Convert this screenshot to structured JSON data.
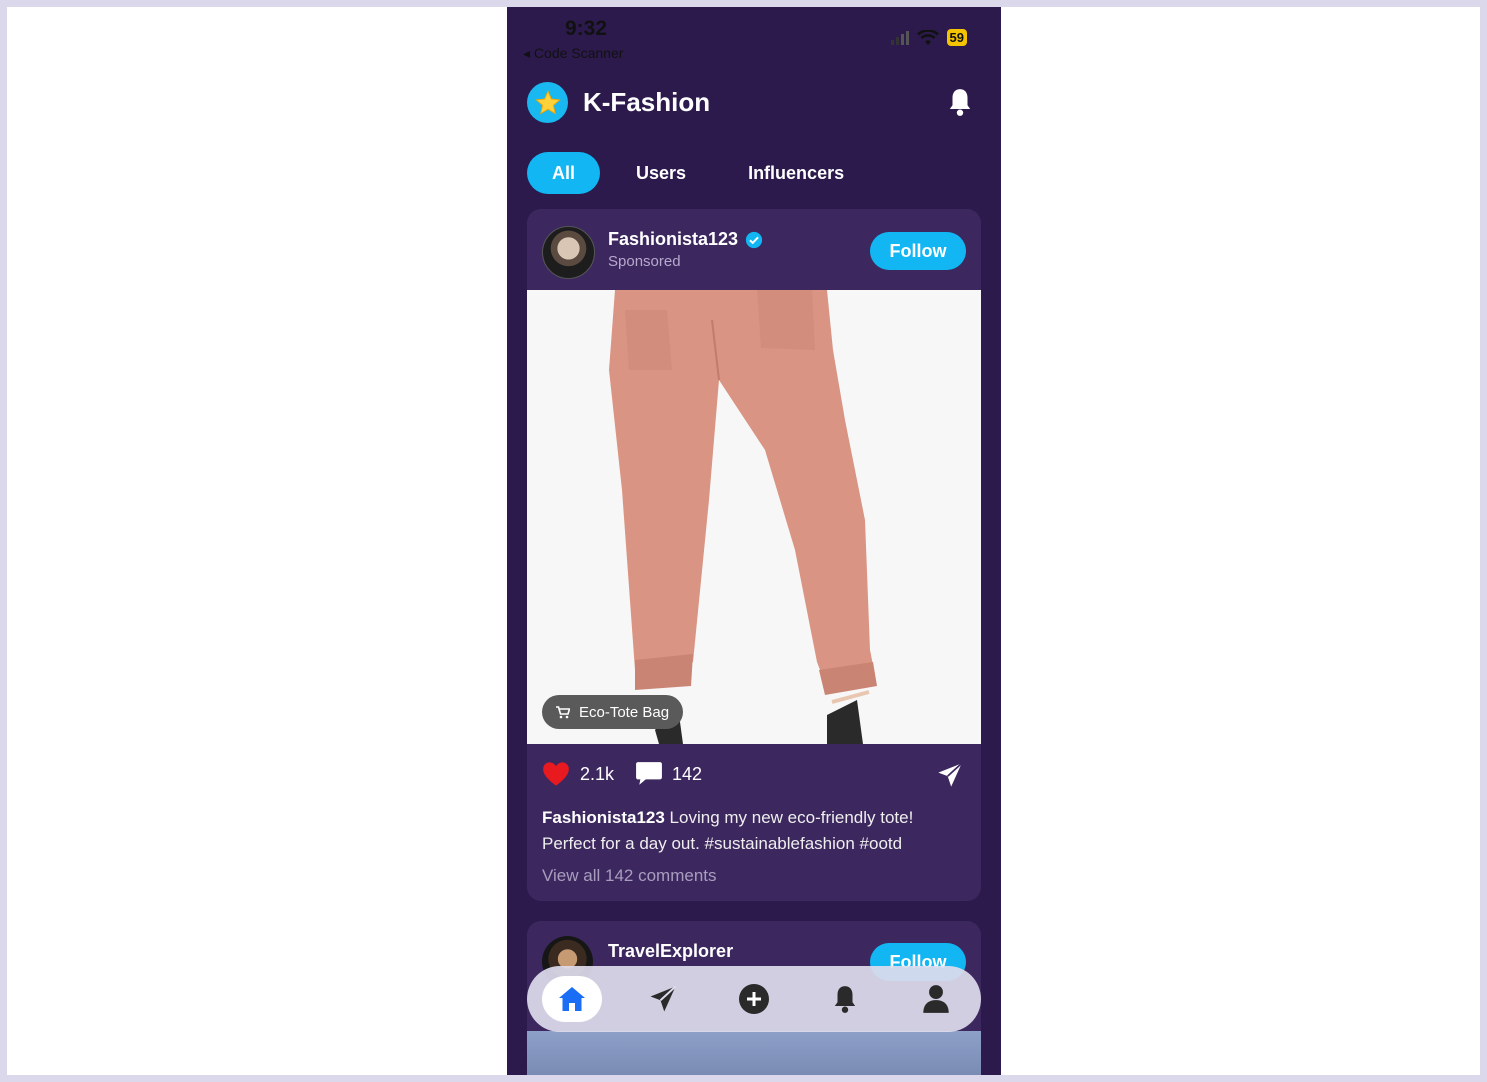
{
  "status_bar": {
    "time": "9:32",
    "back_label": "◂ Code Scanner",
    "battery": "59"
  },
  "header": {
    "title": "K-Fashion"
  },
  "tabs": [
    {
      "label": "All",
      "active": true
    },
    {
      "label": "Users",
      "active": false
    },
    {
      "label": "Influencers",
      "active": false
    }
  ],
  "post": {
    "username": "Fashionista123",
    "verified": true,
    "subtitle": "Sponsored",
    "follow_label": "Follow",
    "product_tag": "Eco-Tote Bag",
    "likes": "2.1k",
    "comments": "142",
    "caption_user": "Fashionista123",
    "caption_text": " Loving my new eco-friendly tote! Perfect for a day out. #sustainablefashion #ootd",
    "view_comments": "View all 142 comments"
  },
  "post2": {
    "username": "TravelExplorer",
    "follow_label": "Follow"
  },
  "bottom_nav": [
    {
      "icon": "home-icon",
      "active": true
    },
    {
      "icon": "send-icon",
      "active": false
    },
    {
      "icon": "plus-circle-icon",
      "active": false
    },
    {
      "icon": "bell-icon",
      "active": false
    },
    {
      "icon": "person-icon",
      "active": false
    }
  ],
  "colors": {
    "background": "#2c1a4d",
    "card": "#3c285f",
    "accent": "#11b6f3",
    "like": "#e8191f"
  }
}
